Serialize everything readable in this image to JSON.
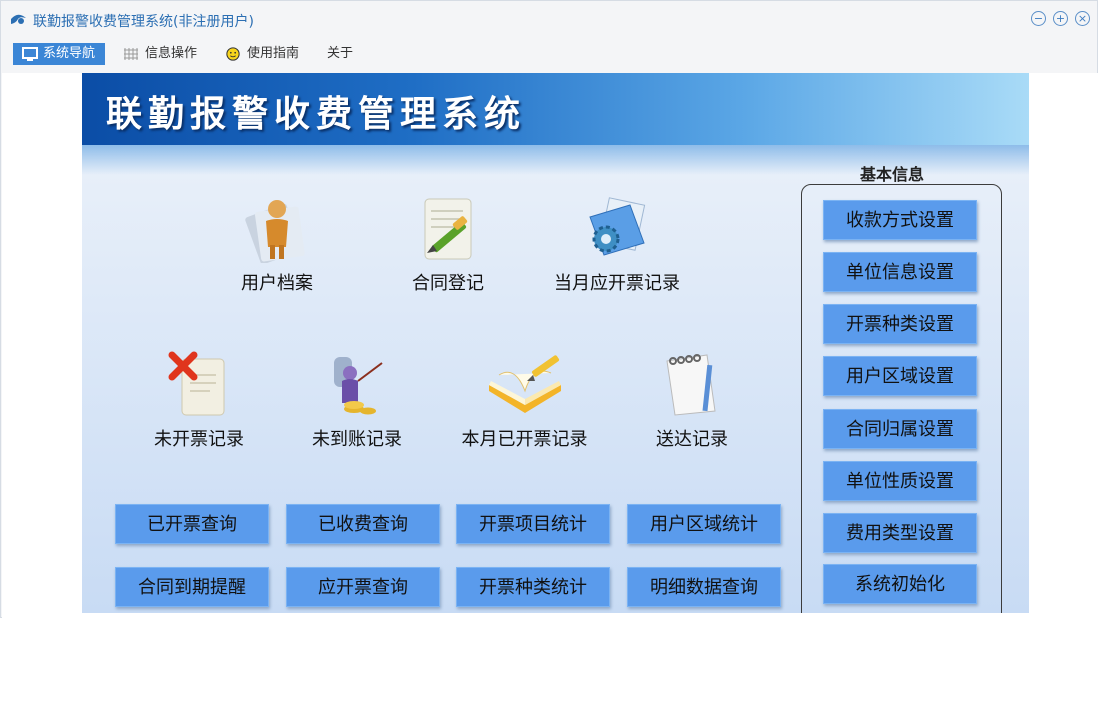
{
  "window": {
    "title": "联勤报警收费管理系统(非注册用户)"
  },
  "menu": {
    "items": [
      {
        "label": "系统导航",
        "icon": "monitor-icon"
      },
      {
        "label": "信息操作",
        "icon": "grid-icon"
      },
      {
        "label": "使用指南",
        "icon": "smiley-icon"
      },
      {
        "label": "关于"
      }
    ]
  },
  "banner": {
    "title": "联勤报警收费管理系统"
  },
  "features": [
    {
      "label": "用户档案",
      "icon": "user-profile-icon"
    },
    {
      "label": "合同登记",
      "icon": "contract-pen-icon"
    },
    {
      "label": "当月应开票记录",
      "icon": "folder-gear-icon"
    },
    {
      "label": "未开票记录",
      "icon": "document-x-icon"
    },
    {
      "label": "未到账记录",
      "icon": "coins-person-icon"
    },
    {
      "label": "本月已开票记录",
      "icon": "book-pencil-icon"
    },
    {
      "label": "送达记录",
      "icon": "notepad-icon"
    }
  ],
  "queries": [
    "已开票查询",
    "已收费查询",
    "开票项目统计",
    "用户区域统计",
    "合同到期提醒",
    "应开票查询",
    "开票种类统计",
    "明细数据查询"
  ],
  "sidebar": {
    "title": "基本信息",
    "buttons": [
      "收款方式设置",
      "单位信息设置",
      "开票种类设置",
      "用户区域设置",
      "合同归属设置",
      "单位性质设置",
      "费用类型设置",
      "系统初始化"
    ]
  },
  "colors": {
    "accent": "#3b86d6",
    "button": "#5a9bec",
    "banner_dark": "#0b4da6",
    "banner_light": "#a9dbf7"
  }
}
